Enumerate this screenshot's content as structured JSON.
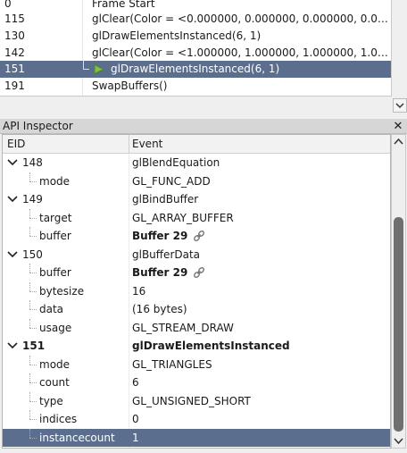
{
  "event_browser": {
    "rows": [
      {
        "eid": "0",
        "name": "Frame Start"
      },
      {
        "eid": "115",
        "name": "glClear(Color = <0.000000, 0.000000, 0.000000, 0.0000..."
      },
      {
        "eid": "130",
        "name": "glDrawElementsInstanced(6, 1)"
      },
      {
        "eid": "142",
        "name": "glClear(Color = <1.000000, 1.000000, 1.000000, 1.0000..."
      },
      {
        "eid": "151",
        "name": "glDrawElementsInstanced(6, 1)"
      },
      {
        "eid": "191",
        "name": "SwapBuffers()"
      }
    ]
  },
  "inspector": {
    "title": "API Inspector",
    "close_glyph": "✕",
    "columns": {
      "eid": "EID",
      "event": "Event"
    },
    "rows": [
      {
        "c1": "148",
        "c2": "glBlendEquation"
      },
      {
        "c1": "mode",
        "c2": "GL_FUNC_ADD"
      },
      {
        "c1": "149",
        "c2": "glBindBuffer"
      },
      {
        "c1": "target",
        "c2": "GL_ARRAY_BUFFER"
      },
      {
        "c1": "buffer",
        "c2": "Buffer 29"
      },
      {
        "c1": "150",
        "c2": "glBufferData"
      },
      {
        "c1": "buffer",
        "c2": "Buffer 29"
      },
      {
        "c1": "bytesize",
        "c2": "16"
      },
      {
        "c1": "data",
        "c2": "(16 bytes)"
      },
      {
        "c1": "usage",
        "c2": "GL_STREAM_DRAW"
      },
      {
        "c1": "151",
        "c2": "glDrawElementsInstanced"
      },
      {
        "c1": "mode",
        "c2": "GL_TRIANGLES"
      },
      {
        "c1": "count",
        "c2": "6"
      },
      {
        "c1": "type",
        "c2": "GL_UNSIGNED_SHORT"
      },
      {
        "c1": "indices",
        "c2": "0"
      },
      {
        "c1": "instancecount",
        "c2": "1"
      }
    ]
  },
  "colors": {
    "selection": "#5b6e8e",
    "play_icon": "#7fbf4a",
    "scroll_thumb": "#6f6f6f"
  },
  "icons": {
    "play": "play-icon",
    "link": "link-icon",
    "expand": "chevron-down-icon"
  }
}
